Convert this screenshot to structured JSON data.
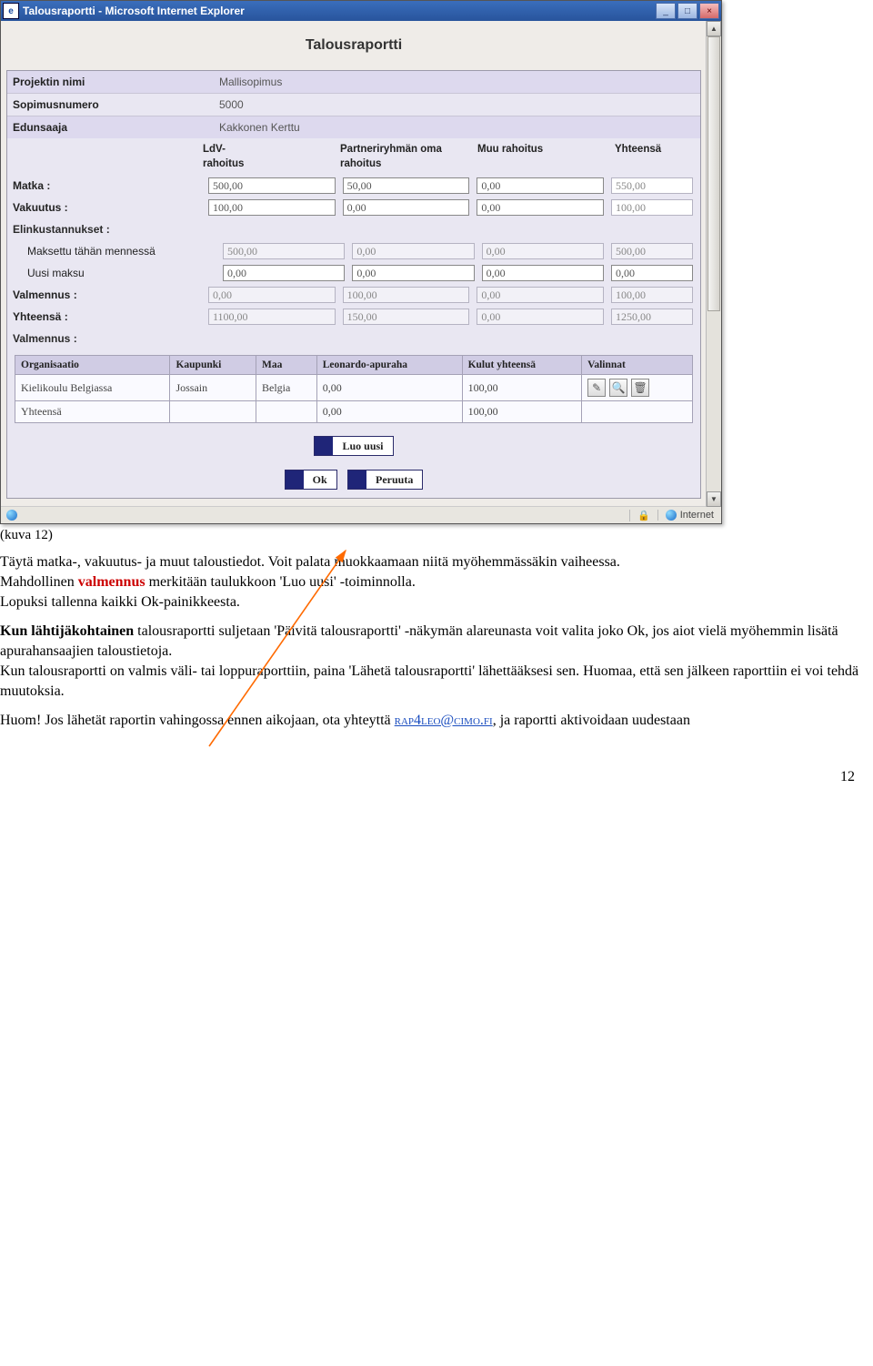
{
  "window": {
    "title": "Talousraportti - Microsoft Internet Explorer",
    "status_zone": "Internet",
    "min": "_",
    "max": "□",
    "close": "×",
    "up": "▲",
    "down": "▼"
  },
  "form": {
    "title": "Talousraportti",
    "labels": {
      "projektin_nimi": "Projektin nimi",
      "sopimusnumero": "Sopimusnumero",
      "edunsaaja": "Edunsaaja",
      "ldv": "LdV-\nrahoitus",
      "partneri": "Partneriryhmän oma rahoitus",
      "muu": "Muu rahoitus",
      "yhteensa": "Yhteensä",
      "matka": "Matka :",
      "vakuutus": "Vakuutus :",
      "elin": "Elinkustannukset :",
      "maksettu": "Maksettu tähän mennessä",
      "uusi": "Uusi maksu",
      "valmennus": "Valmennus :",
      "yhteensa_row": "Yhteensä :",
      "valmennus2": "Valmennus :"
    },
    "values": {
      "projektin_nimi": "Mallisopimus",
      "sopimusnumero": "5000",
      "edunsaaja": "Kakkonen Kerttu"
    },
    "grid": {
      "matka": {
        "ldv": "500,00",
        "p": "50,00",
        "muu": "0,00",
        "yht": "550,00"
      },
      "vakuutus": {
        "ldv": "100,00",
        "p": "0,00",
        "muu": "0,00",
        "yht": "100,00"
      },
      "maksettu": {
        "ldv": "500,00",
        "p": "0,00",
        "muu": "0,00",
        "yht": "500,00"
      },
      "uusi": {
        "ldv": "0,00",
        "p": "0,00",
        "muu": "0,00",
        "yht": "0,00"
      },
      "valmennus": {
        "ldv": "0,00",
        "p": "100,00",
        "muu": "0,00",
        "yht": "100,00"
      },
      "yhteensa": {
        "ldv": "1100,00",
        "p": "150,00",
        "muu": "0,00",
        "yht": "1250,00"
      }
    },
    "inner_table": {
      "headers": [
        "Organisaatio",
        "Kaupunki",
        "Maa",
        "Leonardo-apuraha",
        "Kulut yhteensä",
        "Valinnat"
      ],
      "rows": [
        {
          "org": "Kielikoulu Belgiassa",
          "kaup": "Jossain",
          "maa": "Belgia",
          "leo": "0,00",
          "kulut": "100,00"
        }
      ],
      "footer": {
        "org": "Yhteensä",
        "leo": "0,00",
        "kulut": "100,00"
      }
    },
    "buttons": {
      "luo": "Luo uusi",
      "ok": "Ok",
      "peruuta": "Peruuta"
    }
  },
  "doc": {
    "caption": "(kuva 12)",
    "p1a": "Täytä matka-, vakuutus- ja muut taloustiedot. Voit palata muokkaamaan niitä myöhemmässäkin vaiheessa.",
    "p1b_pre": "Mahdollinen ",
    "p1b_red": "valmennus",
    "p1b_post": " merkitään taulukkoon 'Luo uusi' -toiminnolla.",
    "p1c": "Lopuksi tallenna kaikki Ok-painikkeesta.",
    "p2a_b": "Kun lähtijäkohtainen ",
    "p2a": "talousraportti suljetaan 'Päivitä talousraportti' -näkymän alareunasta voit valita joko Ok, jos aiot vielä myöhemmin lisätä apurahansaajien taloustietoja.",
    "p2b": "Kun talousraportti on valmis väli- tai loppuraporttiin, paina 'Lähetä talousraportti' lähettääksesi sen. Huomaa, että sen jälkeen raporttiin ei voi tehdä muutoksia.",
    "p3_pre": "Huom! Jos lähetät raportin vahingossa ennen aikojaan, ota yhteyttä ",
    "p3_link": "rap4leo@cimo.fi",
    "p3_post": ", ja raportti aktivoidaan uudestaan",
    "pageno": "12"
  }
}
